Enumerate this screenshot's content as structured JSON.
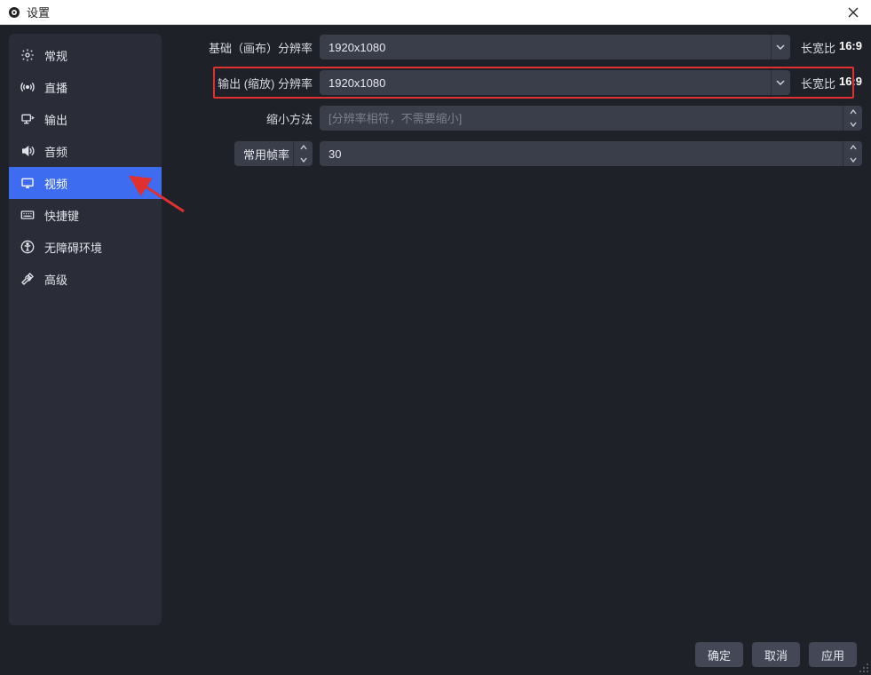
{
  "window": {
    "title": "设置"
  },
  "sidebar": {
    "items": [
      {
        "id": "general",
        "label": "常规"
      },
      {
        "id": "stream",
        "label": "直播"
      },
      {
        "id": "output",
        "label": "输出"
      },
      {
        "id": "audio",
        "label": "音频"
      },
      {
        "id": "video",
        "label": "视频"
      },
      {
        "id": "hotkeys",
        "label": "快捷键"
      },
      {
        "id": "access",
        "label": "无障碍环境"
      },
      {
        "id": "advanced",
        "label": "高级"
      }
    ],
    "active": "video"
  },
  "form": {
    "base_res": {
      "label": "基础（画布）分辨率",
      "value": "1920x1080",
      "aspect_label": "长宽比",
      "aspect_value": "16:9"
    },
    "output_res": {
      "label": "输出 (缩放) 分辨率",
      "value": "1920x1080",
      "aspect_label": "长宽比",
      "aspect_value": "16:9",
      "highlighted": true
    },
    "downscale": {
      "label": "缩小方法",
      "placeholder": "[分辨率相符，不需要缩小]",
      "value": ""
    },
    "fps": {
      "mode_label": "常用帧率",
      "value": "30"
    }
  },
  "buttons": {
    "ok": "确定",
    "cancel": "取消",
    "apply": "应用"
  }
}
